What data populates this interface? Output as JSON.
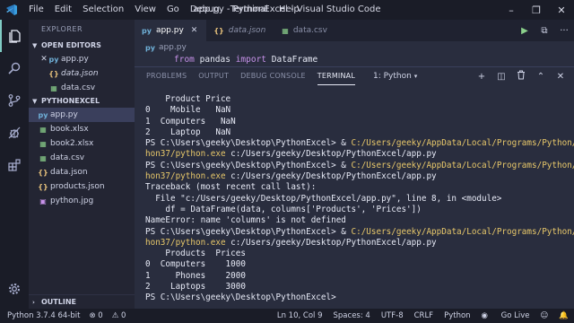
{
  "titlebar": {
    "menu": [
      "File",
      "Edit",
      "Selection",
      "View",
      "Go",
      "Debug",
      "Terminal",
      "Help"
    ],
    "title": "app.py - PythonExcel - Visual Studio Code",
    "minimize": "–",
    "maximize": "❐",
    "close": "✕"
  },
  "activity": [
    "files-icon",
    "search-icon",
    "source-control-icon",
    "debug-icon",
    "extensions-icon",
    "gear-icon"
  ],
  "sidebar": {
    "header": "EXPLORER",
    "open_editors_label": "OPEN EDITORS",
    "open_editors": [
      {
        "name": "app.py",
        "icon": "py",
        "color": "#6fb0d8",
        "italic": false,
        "close": true
      },
      {
        "name": "data.json",
        "icon": "{}",
        "color": "#e5c07b",
        "italic": true,
        "close": false
      },
      {
        "name": "data.csv",
        "icon": "▦",
        "color": "#8bd18b",
        "italic": false,
        "close": false
      }
    ],
    "project_label": "PYTHONEXCEL",
    "files": [
      {
        "name": "app.py",
        "icon": "py",
        "color": "#6fb0d8",
        "selected": true
      },
      {
        "name": "book.xlsx",
        "icon": "▦",
        "color": "#8bd18b",
        "selected": false
      },
      {
        "name": "book2.xlsx",
        "icon": "▦",
        "color": "#8bd18b",
        "selected": false
      },
      {
        "name": "data.csv",
        "icon": "▦",
        "color": "#8bd18b",
        "selected": false
      },
      {
        "name": "data.json",
        "icon": "{}",
        "color": "#e5c07b",
        "selected": false
      },
      {
        "name": "products.json",
        "icon": "{}",
        "color": "#e5c07b",
        "selected": false
      },
      {
        "name": "python.jpg",
        "icon": "▣",
        "color": "#c792ea",
        "selected": false
      }
    ],
    "outline_label": "OUTLINE"
  },
  "tabs": [
    {
      "name": "app.py",
      "icon": "py",
      "color": "#6fb0d8",
      "active": true,
      "italic": false
    },
    {
      "name": "data.json",
      "icon": "{}",
      "color": "#e5c07b",
      "active": false,
      "italic": true
    },
    {
      "name": "data.csv",
      "icon": "▦",
      "color": "#8bd18b",
      "active": false,
      "italic": false
    }
  ],
  "tab_close": "✕",
  "editor_actions": [
    "▶",
    "⧉",
    "···"
  ],
  "breadcrumb": "app.py",
  "code_line": {
    "kw1": "from",
    "mod": "pandas",
    "kw2": "import",
    "name": "DataFrame"
  },
  "panel": {
    "tabs": [
      "PROBLEMS",
      "OUTPUT",
      "DEBUG CONSOLE",
      "TERMINAL"
    ],
    "active_tab": "TERMINAL",
    "terminal_select": "1: Python",
    "tools": [
      "+",
      "◫",
      "🗑",
      "⌃",
      "✕"
    ]
  },
  "terminal": [
    [
      {
        "t": "    Product Price",
        "c": "#e7eaf6"
      }
    ],
    [
      {
        "t": "0    Mobile   NaN",
        "c": "#e7eaf6"
      }
    ],
    [
      {
        "t": "1  Computers   NaN",
        "c": "#e7eaf6"
      }
    ],
    [
      {
        "t": "2    Laptop   NaN",
        "c": "#e7eaf6"
      }
    ],
    [
      {
        "t": "PS C:\\Users\\geeky\\Desktop\\PythonExcel> & ",
        "c": "#e7eaf6"
      },
      {
        "t": "C:/Users/geeky/AppData/Local/Programs/Python/Pyt",
        "c": "#e8c86a"
      }
    ],
    [
      {
        "t": "hon37/python.exe",
        "c": "#e8c86a"
      },
      {
        "t": " c:/Users/geeky/Desktop/PythonExcel/app.py",
        "c": "#e7eaf6"
      }
    ],
    [
      {
        "t": "PS C:\\Users\\geeky\\Desktop\\PythonExcel> & ",
        "c": "#e7eaf6"
      },
      {
        "t": "C:/Users/geeky/AppData/Local/Programs/Python/Pyt",
        "c": "#e8c86a"
      }
    ],
    [
      {
        "t": "hon37/python.exe",
        "c": "#e8c86a"
      },
      {
        "t": " c:/Users/geeky/Desktop/PythonExcel/app.py",
        "c": "#e7eaf6"
      }
    ],
    [
      {
        "t": "Traceback (most recent call last):",
        "c": "#e7eaf6"
      }
    ],
    [
      {
        "t": "  File \"c:/Users/geeky/Desktop/PythonExcel/app.py\", line 8, in <module>",
        "c": "#e7eaf6"
      }
    ],
    [
      {
        "t": "    df = DataFrame(data, columns['Products', 'Prices'])",
        "c": "#e7eaf6"
      }
    ],
    [
      {
        "t": "NameError: name 'columns' is not defined",
        "c": "#e7eaf6"
      }
    ],
    [
      {
        "t": "PS C:\\Users\\geeky\\Desktop\\PythonExcel> & ",
        "c": "#e7eaf6"
      },
      {
        "t": "C:/Users/geeky/AppData/Local/Programs/Python/Pyt",
        "c": "#e8c86a"
      }
    ],
    [
      {
        "t": "hon37/python.exe",
        "c": "#e8c86a"
      },
      {
        "t": " c:/Users/geeky/Desktop/PythonExcel/app.py",
        "c": "#e7eaf6"
      }
    ],
    [
      {
        "t": "    Products  Prices",
        "c": "#e7eaf6"
      }
    ],
    [
      {
        "t": "0  Computers    1000",
        "c": "#e7eaf6"
      }
    ],
    [
      {
        "t": "1     Phones    2000",
        "c": "#e7eaf6"
      }
    ],
    [
      {
        "t": "2    Laptops    3000",
        "c": "#e7eaf6"
      }
    ],
    [
      {
        "t": "PS C:\\Users\\geeky\\Desktop\\PythonExcel> ",
        "c": "#e7eaf6"
      }
    ]
  ],
  "statusbar": {
    "python": "Python 3.7.4 64-bit",
    "errors": "⊗ 0",
    "warnings": "⚠ 0",
    "position": "Ln 10, Col 9",
    "spaces": "Spaces: 4",
    "encoding": "UTF-8",
    "eol": "CRLF",
    "language": "Python",
    "golive": "Go Live",
    "feedback": "☺",
    "bell": "🔔"
  },
  "colors": {
    "accent": "#80cbc4",
    "keyword": "#c792ea",
    "bg": "#292d3e"
  }
}
